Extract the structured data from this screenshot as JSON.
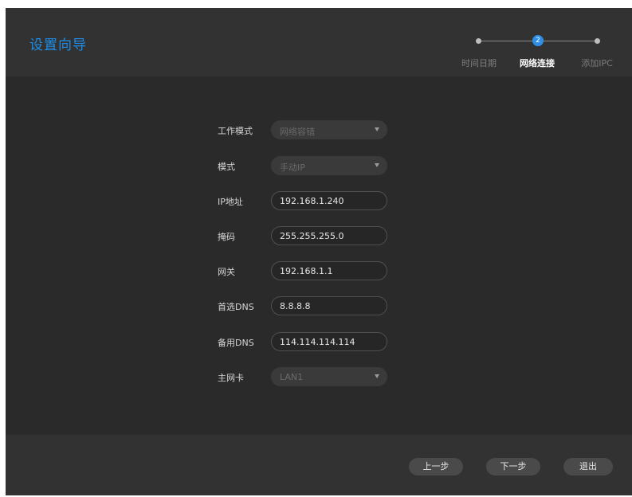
{
  "header": {
    "title": "设置向导",
    "steps": [
      {
        "number": "",
        "label": "时间日期",
        "state": "done"
      },
      {
        "number": "2",
        "label": "网络连接",
        "state": "active"
      },
      {
        "number": "",
        "label": "添加IPC",
        "state": "pending"
      }
    ]
  },
  "form": {
    "work_mode": {
      "label": "工作模式",
      "value": "网络容错"
    },
    "mode": {
      "label": "模式",
      "value": "手动IP"
    },
    "ip": {
      "label": "IP地址",
      "value": "192.168.1.240"
    },
    "mask": {
      "label": "掩码",
      "value": "255.255.255.0"
    },
    "gateway": {
      "label": "网关",
      "value": "192.168.1.1"
    },
    "dns1": {
      "label": "首选DNS",
      "value": "8.8.8.8"
    },
    "dns2": {
      "label": "备用DNS",
      "value": "114.114.114.114"
    },
    "nic": {
      "label": "主网卡",
      "value": "LAN1"
    }
  },
  "footer": {
    "prev_label": "上一步",
    "next_label": "下一步",
    "exit_label": "退出"
  },
  "colors": {
    "accent": "#1e8ee8",
    "background": "#2a2a2a",
    "header_bg": "#323232"
  },
  "icons": {
    "dropdown": "chevron-down-icon"
  }
}
